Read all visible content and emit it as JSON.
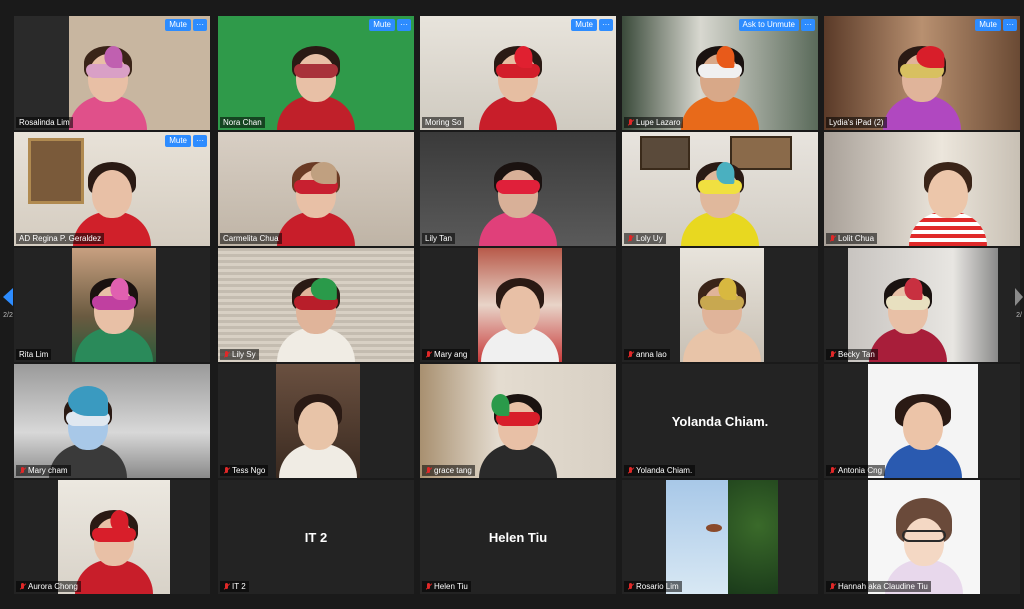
{
  "pager": {
    "indicator_left": "2/2",
    "indicator_right": "2/"
  },
  "colors": {
    "accent": "#2d8cff",
    "muted_mic": "#e02828"
  },
  "tiles": [
    {
      "name": "Rosalinda Lim",
      "muted": false,
      "button": "Mute"
    },
    {
      "name": "Nora Chan",
      "muted": false,
      "button": "Mute"
    },
    {
      "name": "Moring So",
      "muted": false,
      "button": "Mute"
    },
    {
      "name": "Lupe Lazaro",
      "muted": true,
      "button": "Ask to Unmute"
    },
    {
      "name": "Lydia's iPad (2)",
      "muted": false,
      "button": "Mute"
    },
    {
      "name": "AD Regina P. Geraldez",
      "muted": false,
      "button": "Mute"
    },
    {
      "name": "Carmelita Chua",
      "muted": false
    },
    {
      "name": "Lily Tan",
      "muted": false
    },
    {
      "name": "Loly Uy",
      "muted": true
    },
    {
      "name": "Lolit Chua",
      "muted": true
    },
    {
      "name": "Rita Lim",
      "muted": false
    },
    {
      "name": "Lily Sy",
      "muted": true
    },
    {
      "name": "Mary ang",
      "muted": true
    },
    {
      "name": "anna lao",
      "muted": true
    },
    {
      "name": "Becky Tan",
      "muted": true
    },
    {
      "name": "Mary cham",
      "muted": true
    },
    {
      "name": "Tess Ngo",
      "muted": true
    },
    {
      "name": "grace tang",
      "muted": true
    },
    {
      "name": "Yolanda Chiam.",
      "muted": true,
      "display": "Yolanda Chiam."
    },
    {
      "name": "Antonia Cng",
      "muted": true
    },
    {
      "name": "Aurora Chong",
      "muted": true
    },
    {
      "name": "IT 2",
      "muted": true,
      "display": "IT 2"
    },
    {
      "name": "Helen Tiu",
      "muted": true,
      "display": "Helen Tiu"
    },
    {
      "name": "Rosario Lim",
      "muted": true
    },
    {
      "name": "Hannah aka Claudine Tiu",
      "muted": true
    }
  ],
  "more_label": "···"
}
